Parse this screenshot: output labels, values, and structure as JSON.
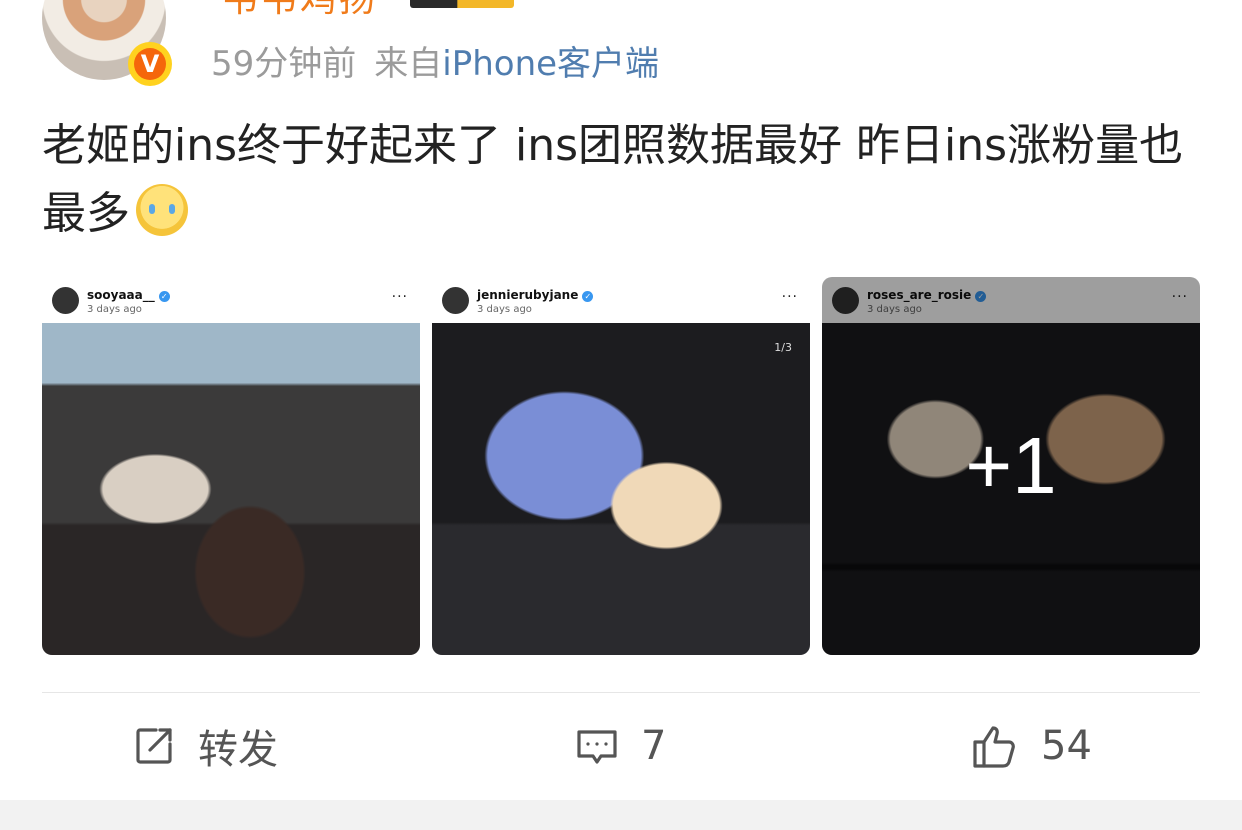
{
  "post": {
    "author": "韦韦鸡扬",
    "vip_badge_icon": "vip-level-badge",
    "verified_icon": "v-badge-icon",
    "time": "59分钟前",
    "source_prefix": "来自",
    "source_client": "iPhone客户端",
    "text": "老姬的ins终于好起来了 ins团照数据最好 昨日ins涨粉量也最多",
    "emoji": "crying-cover-mouth-emoji"
  },
  "images": [
    {
      "ig_user": "sooyaaa__",
      "ig_time": "3 days ago",
      "ig_more": "···"
    },
    {
      "ig_user": "jennierubyjane",
      "ig_time": "3 days ago",
      "ig_more": "···",
      "page_indicator": "1/3"
    },
    {
      "ig_user": "roses_are_rosie",
      "ig_time": "3 days ago",
      "ig_more": "···",
      "more_count": "+1"
    }
  ],
  "actions": {
    "repost_label": "转发",
    "comment_count": "7",
    "like_count": "54"
  },
  "colors": {
    "username": "#f07b1a",
    "link": "#507daf",
    "meta": "#9b9b9b",
    "text": "#222222",
    "action": "#555555"
  }
}
